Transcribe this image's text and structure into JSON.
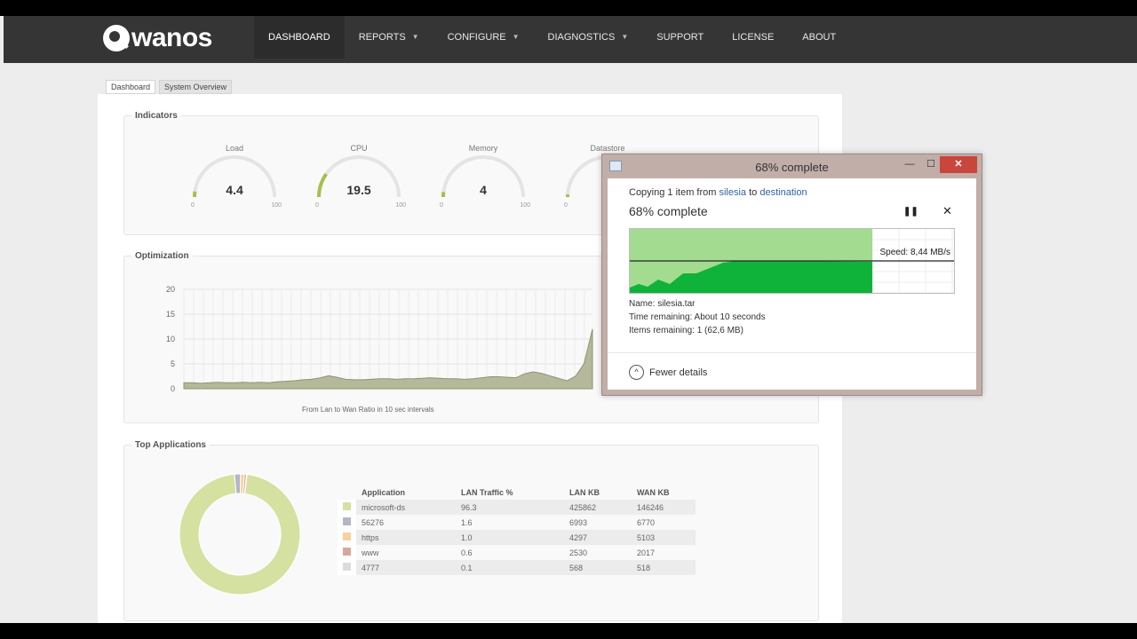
{
  "app": {
    "logo_text": "wanos"
  },
  "nav": [
    {
      "label": "DASHBOARD",
      "caret": false,
      "active": true
    },
    {
      "label": "REPORTS",
      "caret": true
    },
    {
      "label": "CONFIGURE",
      "caret": true
    },
    {
      "label": "DIAGNOSTICS",
      "caret": true
    },
    {
      "label": "SUPPORT",
      "caret": false
    },
    {
      "label": "LICENSE",
      "caret": false
    },
    {
      "label": "ABOUT",
      "caret": false
    }
  ],
  "tabs": [
    "Dashboard",
    "System Overview"
  ],
  "indicators": {
    "legend": "Indicators",
    "gauges": [
      {
        "label": "Load",
        "value": "4.4",
        "level": 4.4,
        "min": "0",
        "max": "100"
      },
      {
        "label": "CPU",
        "value": "19.5",
        "level": 19.5,
        "min": "0",
        "max": "100"
      },
      {
        "label": "Memory",
        "value": "4",
        "level": 4,
        "min": "0",
        "max": "100"
      },
      {
        "label": "Datastore",
        "value": "",
        "level": 2,
        "min": "0",
        "max": "100"
      }
    ],
    "gauge_color": "#a5c04a"
  },
  "optimization": {
    "legend": "Optimization",
    "caption": "From Lan to Wan Ratio in 10 sec intervals",
    "chart_data": {
      "type": "area",
      "y_ticks": [
        "20",
        "15",
        "10",
        "5",
        "0"
      ],
      "ylim": [
        0,
        20
      ],
      "values": [
        1.2,
        1.2,
        1.1,
        1.2,
        1.3,
        1.2,
        1.2,
        1.3,
        1.2,
        1.3,
        1.2,
        1.4,
        1.5,
        1.6,
        1.8,
        1.9,
        2.2,
        2.6,
        2.3,
        1.9,
        1.8,
        1.8,
        1.9,
        2.0,
        2.0,
        1.9,
        2.0,
        2.0,
        2.1,
        2.2,
        2.1,
        2.0,
        2.0,
        1.9,
        2.0,
        2.2,
        2.4,
        2.4,
        2.3,
        2.2,
        3.0,
        3.4,
        3.1,
        2.6,
        2.1,
        1.6,
        2.5,
        5.0,
        12.0
      ],
      "fill": "#b5b89a"
    }
  },
  "top_apps": {
    "legend": "Top Applications",
    "headers": [
      "Application",
      "LAN Traffic %",
      "LAN KB",
      "WAN KB"
    ],
    "rows": [
      {
        "color": "#d4e1a1",
        "app": "microsoft-ds",
        "pct": "96.3",
        "lan": "425862",
        "wan": "146246"
      },
      {
        "color": "#b3b6c9",
        "app": "56276",
        "pct": "1.6",
        "lan": "6993",
        "wan": "6770"
      },
      {
        "color": "#f7d29a",
        "app": "https",
        "pct": "1.0",
        "lan": "4297",
        "wan": "5103"
      },
      {
        "color": "#d9a89a",
        "app": "www",
        "pct": "0.6",
        "lan": "2530",
        "wan": "2017"
      },
      {
        "color": "#dcdcdc",
        "app": "4777",
        "pct": "0.1",
        "lan": "568",
        "wan": "518"
      }
    ],
    "chart_data": {
      "type": "pie",
      "categories": [
        "microsoft-ds",
        "56276",
        "https",
        "www",
        "4777"
      ],
      "values": [
        96.3,
        1.6,
        1.0,
        0.6,
        0.1
      ],
      "colors": [
        "#d4e1a1",
        "#b3b6c9",
        "#f7d29a",
        "#d9a89a",
        "#dcdcdc"
      ]
    }
  },
  "dialog": {
    "title": "68% complete",
    "copy_prefix": "Copying 1 item from ",
    "source": "silesia",
    "to_word": " to ",
    "dest": "destination",
    "percent_text": "68% complete",
    "progress": 0.68,
    "speed": "Speed: 8,44 MB/s",
    "name": "Name: silesia.tar",
    "time_remaining": "Time remaining: About 10 seconds",
    "items_remaining": "Items remaining: 1 (62,6 MB)",
    "fewer_details": "Fewer details",
    "pause_icon": "pause-icon",
    "close_icon": "close-icon",
    "fill_light": "#a3dc90",
    "fill_dark": "#0fb33a"
  }
}
